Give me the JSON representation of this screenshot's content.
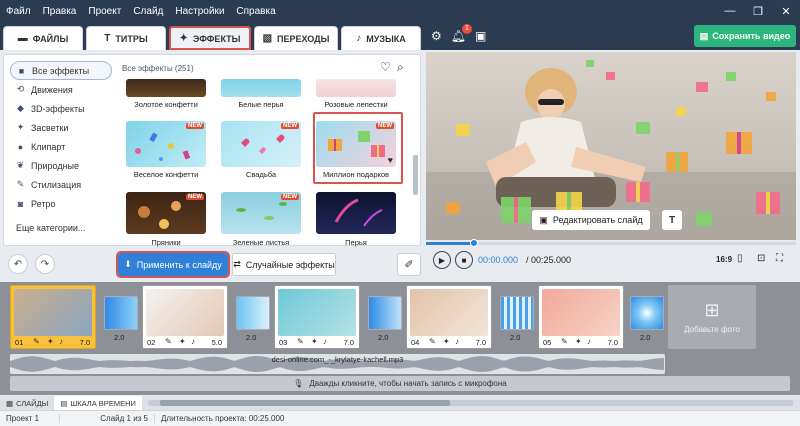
{
  "menu": [
    "Файл",
    "Правка",
    "Проект",
    "Слайд",
    "Настройки",
    "Справка"
  ],
  "window_controls": [
    "—",
    "❐",
    "✕"
  ],
  "tabs": [
    {
      "label": "ФАЙЛЫ",
      "icon": "folder-icon"
    },
    {
      "label": "ТИТРЫ",
      "icon": "text-icon"
    },
    {
      "label": "ЭФФЕКТЫ",
      "icon": "sparkle-icon"
    },
    {
      "label": "ПЕРЕХОДЫ",
      "icon": "transition-icon"
    },
    {
      "label": "МУЗЫКА",
      "icon": "music-icon"
    }
  ],
  "notification_count": "1",
  "save_button": "Сохранить видео",
  "categories": [
    {
      "label": "Все эффекты",
      "icon": "grid-icon"
    },
    {
      "label": "Движения",
      "icon": "motion-icon"
    },
    {
      "label": "3D-эффекты",
      "icon": "cube-icon"
    },
    {
      "label": "Засветки",
      "icon": "sparkle-icon"
    },
    {
      "label": "Клипарт",
      "icon": "clipart-icon"
    },
    {
      "label": "Природные",
      "icon": "leaf-icon"
    },
    {
      "label": "Стилизация",
      "icon": "style-icon"
    },
    {
      "label": "Ретро",
      "icon": "camera-icon"
    }
  ],
  "more_categories": "Еще категории...",
  "grid_header": "Все эффекты (251)",
  "effects": [
    {
      "label": "Золотое конфетти",
      "new": false
    },
    {
      "label": "Белые перья",
      "new": false
    },
    {
      "label": "Розовые лепестки",
      "new": false
    },
    {
      "label": "Веселое конфетти",
      "new": true
    },
    {
      "label": "Свадьба",
      "new": true
    },
    {
      "label": "Миллион подарков",
      "new": true
    },
    {
      "label": "Пряники",
      "new": true
    },
    {
      "label": "Зеленые листья",
      "new": true
    },
    {
      "label": "Перья",
      "new": false
    }
  ],
  "new_tag": "NEW",
  "apply_button": "Применить к слайду",
  "random_button": "Случайные эффекты",
  "edit_slide_button": "Редактировать слайд",
  "playback": {
    "current": "00:00.000",
    "total": "/ 00:25.000",
    "ratio": "16:9",
    "progress": 0.13
  },
  "slides": [
    {
      "num": "01",
      "dur": "7.0"
    },
    {
      "num": "02",
      "dur": "5.0"
    },
    {
      "num": "03",
      "dur": "7.0"
    },
    {
      "num": "04",
      "dur": "7.0"
    },
    {
      "num": "05",
      "dur": "7.0"
    }
  ],
  "transition_durations": [
    "2.0",
    "2.0",
    "2.0",
    "2.0",
    "2.0"
  ],
  "add_photo": "Добавьте фото",
  "audio_file": "desi-online.com_-_krylatye-kachell.mp3",
  "mic_hint": "Дважды кликните, чтобы начать запись с микрофона",
  "bottom_tabs": [
    "СЛАЙДЫ",
    "ШКАЛА ВРЕМЕНИ"
  ],
  "status": [
    "Проект 1",
    "Слайд 1 из 5",
    "Длительность проекта: 00:25.000"
  ]
}
